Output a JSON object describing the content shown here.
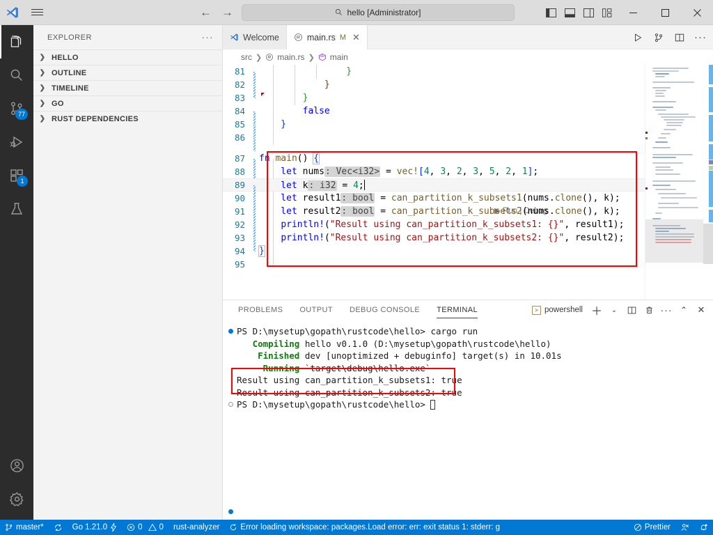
{
  "titlebar": {
    "search_value": "hello [Administrator]",
    "search_icon": "search-icon",
    "back_arrow": "←",
    "forward_arrow": "→",
    "minimize": "—",
    "maximize": "▢",
    "close": "✕"
  },
  "activitybar": {
    "items": [
      {
        "name": "explorer",
        "badge": ""
      },
      {
        "name": "search",
        "badge": ""
      },
      {
        "name": "source-control",
        "badge": "77"
      },
      {
        "name": "run-and-debug",
        "badge": ""
      },
      {
        "name": "extensions",
        "badge": "1"
      },
      {
        "name": "testing",
        "badge": ""
      }
    ],
    "bottom": [
      {
        "name": "accounts"
      },
      {
        "name": "manage-settings"
      }
    ]
  },
  "sidebar": {
    "title": "EXPLORER",
    "more_actions": "···",
    "sections": [
      {
        "label": "HELLO",
        "expanded": false
      },
      {
        "label": "OUTLINE",
        "expanded": false
      },
      {
        "label": "TIMELINE",
        "expanded": false
      },
      {
        "label": "GO",
        "expanded": false
      },
      {
        "label": "RUST DEPENDENCIES",
        "expanded": false
      }
    ]
  },
  "editor": {
    "tabs": [
      {
        "label": "Welcome",
        "active": false,
        "dirty": "",
        "closable": false
      },
      {
        "label": "main.rs",
        "active": true,
        "dirty": "M",
        "closable": true
      }
    ],
    "tab_actions": [
      "run-icon",
      "split-source-control-icon",
      "split-editor-icon",
      "more-actions-icon"
    ],
    "breadcrumb": [
      "src",
      "main.rs",
      "main"
    ],
    "codelens": "▶ Run | Debug",
    "first_visible_line": 81,
    "current_line": 89,
    "lines": [
      {
        "n": 81,
        "modified": true,
        "indent": 4,
        "text": "                }"
      },
      {
        "n": 82,
        "modified": true,
        "indent": 3,
        "text": "            }"
      },
      {
        "n": 83,
        "modified": false,
        "indent": 2,
        "text": "        }"
      },
      {
        "n": 84,
        "modified": true,
        "indent": 2,
        "text": "        false"
      },
      {
        "n": 85,
        "modified": true,
        "indent": 1,
        "text": "    }"
      },
      {
        "n": 86,
        "modified": true,
        "indent": 0,
        "text": ""
      },
      {
        "n": 87,
        "modified": true,
        "indent": 0,
        "text": "fn main() {"
      },
      {
        "n": 88,
        "modified": true,
        "indent": 1,
        "text": "    let nums: Vec<i32> = vec![4, 3, 2, 3, 5, 2, 1];"
      },
      {
        "n": 89,
        "modified": true,
        "indent": 1,
        "text": "    let k: i32 = 4;"
      },
      {
        "n": 90,
        "modified": true,
        "indent": 1,
        "text": "    let result1: bool = can_partition_k_subsets1(nums.clone(), k);"
      },
      {
        "n": 91,
        "modified": true,
        "indent": 1,
        "text": "    let result2: bool = can_partition_k_subsets2(nums.clone(), k);"
      },
      {
        "n": 92,
        "modified": true,
        "indent": 1,
        "text": "    println!(\"Result using can_partition_k_subsets1: {}\", result1);"
      },
      {
        "n": 93,
        "modified": true,
        "indent": 1,
        "text": "    println!(\"Result using can_partition_k_subsets2: {}\", result2);"
      },
      {
        "n": 94,
        "modified": false,
        "indent": 0,
        "text": "}"
      },
      {
        "n": 95,
        "modified": false,
        "indent": 0,
        "text": ""
      }
    ],
    "inlay_hints": [
      "Vec<i32>",
      "i32",
      "bool",
      "bool"
    ],
    "highlight_box_label": "fn-main-highlight"
  },
  "panel": {
    "tabs": [
      {
        "label": "PROBLEMS",
        "active": false
      },
      {
        "label": "OUTPUT",
        "active": false
      },
      {
        "label": "DEBUG CONSOLE",
        "active": false
      },
      {
        "label": "TERMINAL",
        "active": true
      }
    ],
    "terminal_name": "powershell",
    "actions": [
      "new-terminal-icon",
      "terminal-dropdown-icon",
      "split-terminal-icon",
      "kill-terminal-icon",
      "more-actions-icon",
      "maximize-panel-icon",
      "close-panel-icon"
    ],
    "terminal_lines": [
      {
        "marker": "blue",
        "segments": [
          {
            "cls": "plain",
            "t": "PS D:\\mysetup\\gopath\\rustcode\\hello> cargo run"
          }
        ]
      },
      {
        "marker": "none",
        "segments": [
          {
            "cls": "green",
            "t": "   Compiling"
          },
          {
            "cls": "plain",
            "t": " hello v0.1.0 (D:\\mysetup\\gopath\\rustcode\\hello)"
          }
        ]
      },
      {
        "marker": "none",
        "segments": [
          {
            "cls": "green",
            "t": "    Finished"
          },
          {
            "cls": "plain",
            "t": " dev [unoptimized + debuginfo] target(s) in 10.01s"
          }
        ]
      },
      {
        "marker": "none",
        "segments": [
          {
            "cls": "green",
            "t": "     Running"
          },
          {
            "cls": "plain",
            "t": " `target\\debug\\hello.exe`"
          }
        ]
      },
      {
        "marker": "none",
        "segments": [
          {
            "cls": "plain",
            "t": "Result using can_partition_k_subsets1: true"
          }
        ]
      },
      {
        "marker": "none",
        "segments": [
          {
            "cls": "plain",
            "t": "Result using can_partition_k_subsets2: true"
          }
        ]
      },
      {
        "marker": "hollow",
        "segments": [
          {
            "cls": "plain",
            "t": "PS D:\\mysetup\\gopath\\rustcode\\hello> "
          }
        ]
      }
    ],
    "highlight_box_label": "terminal-output-highlight"
  },
  "statusbar": {
    "left": [
      {
        "icon": "source-control-icon",
        "label": "master*"
      },
      {
        "icon": "sync-icon",
        "label": ""
      },
      {
        "icon": "",
        "label": "Go 1.21.0",
        "suffix_icon": "go-lightning-icon"
      },
      {
        "icon": "error-icon",
        "label": "0",
        "icon2": "warning-icon",
        "label2": "0"
      },
      {
        "icon": "",
        "label": "rust-analyzer"
      },
      {
        "icon": "sync-spin-icon",
        "label": "Error loading workspace: packages.Load error: err: exit status 1: stderr: g"
      }
    ],
    "right": [
      {
        "icon": "prettier-icon",
        "label": "Prettier"
      },
      {
        "icon": "remote-feedback-icon",
        "label": ""
      },
      {
        "icon": "bell-dot-icon",
        "label": ""
      }
    ]
  },
  "colors": {
    "accent": "#0078d4",
    "highlight_red": "#ff0000",
    "titlebar_bg": "#dddddd",
    "activitybar_bg": "#2c2c2c",
    "sidebar_bg": "#f3f3f3",
    "editor_bg": "#ffffff",
    "statusbar_bg": "#0078d4",
    "keyword_blue": "#0000ff",
    "string_red": "#a31515",
    "number_green": "#098658",
    "function_gold": "#795e26",
    "linenum_blue": "#237893",
    "terminal_green": "#107c10"
  }
}
